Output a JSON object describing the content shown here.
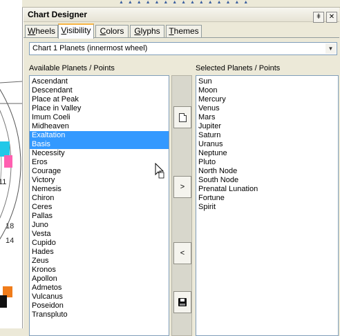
{
  "chart_background": {
    "numbers": [
      "11",
      "18",
      "14"
    ]
  },
  "panel": {
    "title": "Chart Designer",
    "pin_icon": "pin-icon",
    "close_icon": "close-icon",
    "tabs": [
      {
        "label": "Wheels",
        "accel": "W",
        "rest": "heels"
      },
      {
        "label": "Visibility",
        "accel": "V",
        "rest": "isibility",
        "active": true
      },
      {
        "label": "Colors",
        "accel": "C",
        "rest": "olors"
      },
      {
        "label": "Glyphs",
        "accel": "G",
        "rest": "lyphs"
      },
      {
        "label": "Themes",
        "accel": "T",
        "rest": "hemes"
      }
    ],
    "wheel_select": {
      "value": "Chart 1 Planets (innermost wheel)"
    },
    "available_label": "Available Planets / Points",
    "selected_label": "Selected Planets / Points",
    "available_items": [
      "Ascendant",
      "Descendant",
      "Place at Peak",
      "Place in Valley",
      "Imum Coeli",
      "Midheaven",
      "Exaltation",
      "Basis",
      "Necessity",
      "Eros",
      "Courage",
      "Victory",
      "Nemesis",
      "Chiron",
      "Ceres",
      "Pallas",
      "Juno",
      "Vesta",
      "Cupido",
      "Hades",
      "Zeus",
      "Kronos",
      "Apollon",
      "Admetos",
      "Vulcanus",
      "Poseidon",
      "Transpluto"
    ],
    "available_selected": [
      "Exaltation",
      "Basis"
    ],
    "selected_items": [
      "Sun",
      "Moon",
      "Mercury",
      "Venus",
      "Mars",
      "Jupiter",
      "Saturn",
      "Uranus",
      "Neptune",
      "Pluto",
      "North Node",
      "South Node",
      "Prenatal Lunation",
      "Fortune",
      "Spirit"
    ],
    "buttons": {
      "new_icon": "new-document-icon",
      "add_label": ">",
      "remove_label": "<",
      "save_icon": "save-icon"
    }
  }
}
